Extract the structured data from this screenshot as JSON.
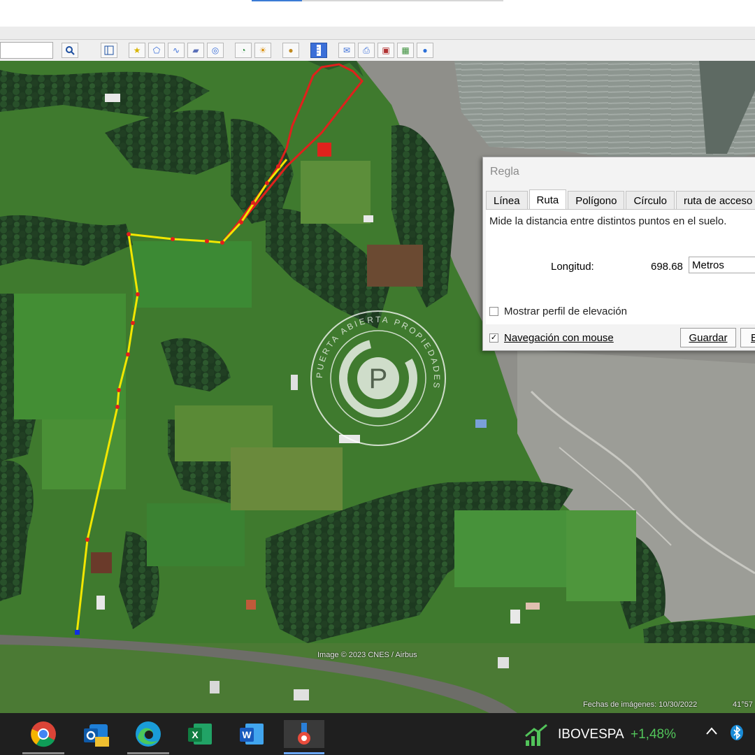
{
  "toolbar": {
    "search_value": "",
    "icons": [
      "search-icon",
      "sidebar-icon",
      "placemark-icon",
      "polygon-icon",
      "path-icon",
      "overlay-icon",
      "tour-icon",
      "historical-imagery-icon",
      "sunlight-icon",
      "planets-icon",
      "ruler-icon",
      "email-icon",
      "print-icon",
      "save-image-icon",
      "map-view-icon",
      "earth-icon"
    ]
  },
  "map": {
    "image_credit": "Image © 2023 CNES / Airbus",
    "imagery_dates": "Fechas de imágenes: 10/30/2022",
    "coordinate_fragment": "41°57",
    "route_color": "#f2e600",
    "boundary_color": "#e0201c"
  },
  "watermark": {
    "ring_text": "PUERTA ABIERTA PROPIEDADES",
    "letter": "P"
  },
  "ruler_dialog": {
    "title": "Regla",
    "tabs": [
      "Línea",
      "Ruta",
      "Polígono",
      "Círculo",
      "ruta de acceso"
    ],
    "active_tab": "Ruta",
    "description": "Mide la distancia entre distintos puntos en el suelo.",
    "length_label": "Longitud:",
    "length_value": "698.68",
    "unit": "Metros",
    "elevation_profile_label": "Mostrar perfil de elevación",
    "elevation_profile_checked": false,
    "mouse_nav_label": "Navegación con mouse",
    "mouse_nav_checked": true,
    "save_button": "Guardar",
    "second_button": "B"
  },
  "taskbar": {
    "apps": [
      "chrome-icon",
      "outlook-icon",
      "edge-icon",
      "excel-icon",
      "word-icon",
      "google-earth-icon"
    ],
    "stock_name": "IBOVESPA",
    "stock_change": "+1,48%"
  }
}
